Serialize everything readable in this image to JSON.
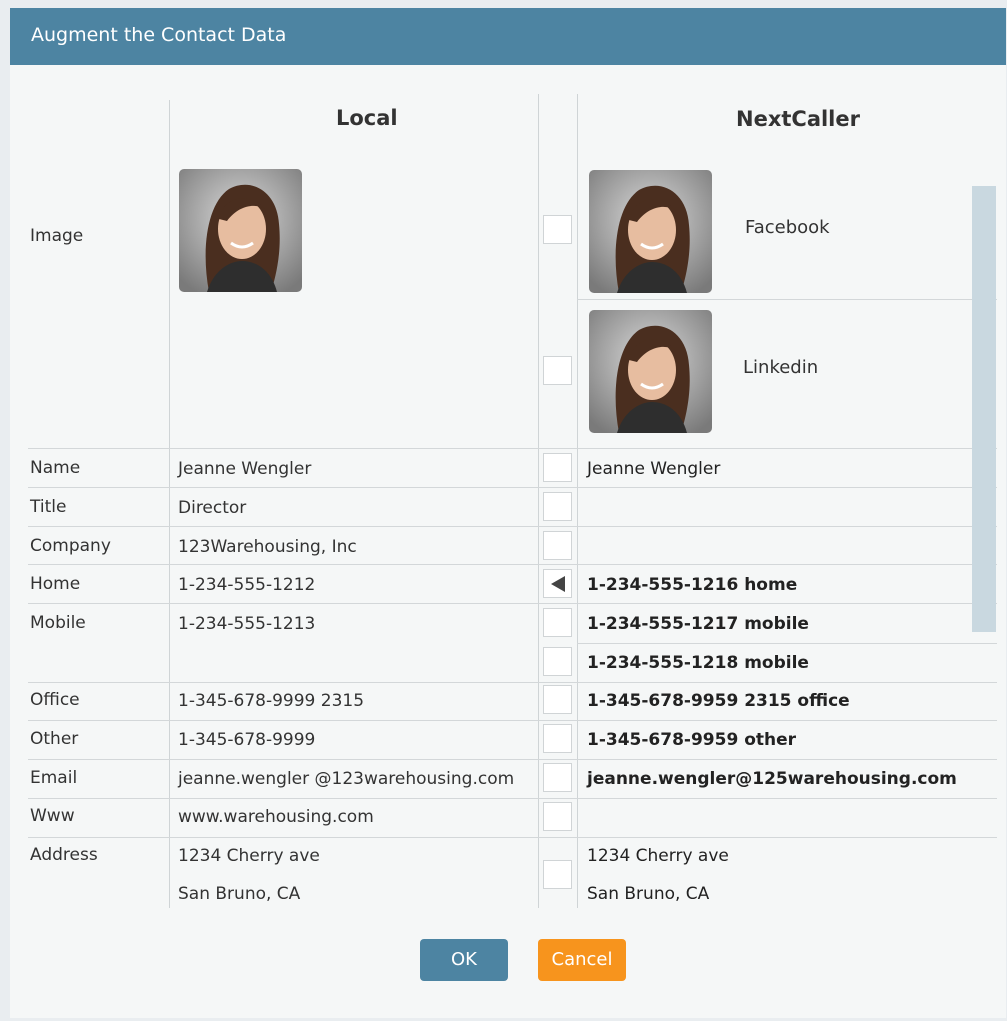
{
  "dialog": {
    "title": "Augment the Contact Data",
    "columns": {
      "local": "Local",
      "remote": "NextCaller"
    },
    "images": [
      {
        "source": "Facebook"
      },
      {
        "source": "Linkedin"
      }
    ],
    "labels": {
      "image": "Image",
      "name": "Name",
      "title": "Title",
      "company": "Company",
      "home": "Home",
      "mobile": "Mobile",
      "office": "Office",
      "other": "Other",
      "email": "Email",
      "www": "Www",
      "address": "Address"
    },
    "local": {
      "name": "Jeanne Wengler",
      "title": "Director",
      "company": "123Warehousing, Inc",
      "home": "1-234-555-1212",
      "mobile": "1-234-555-1213",
      "office": "1-345-678-9999 2315",
      "other": "1-345-678-9999",
      "email": "jeanne.wengler @123warehousing.com",
      "www": "www.warehousing.com",
      "address_line1": "1234 Cherry ave",
      "address_line2": "San Bruno, CA"
    },
    "remote": {
      "name": "Jeanne Wengler",
      "home": "1-234-555-1216 home",
      "mobile1": "1-234-555-1217 mobile",
      "mobile2": "1-234-555-1218 mobile",
      "office": "1-345-678-9959 2315 office",
      "other": "1-345-678-9959 other",
      "email": "jeanne.wengler@125warehousing.com",
      "address_line1": "1234 Cherry ave",
      "address_line2": "San Bruno, CA"
    },
    "buttons": {
      "ok": "OK",
      "cancel": "Cancel"
    },
    "colors": {
      "header": "#4d84a2",
      "ok": "#4d84a2",
      "cancel": "#f7941d"
    },
    "icons": {
      "merge_arrow": "arrow-left-icon"
    }
  }
}
